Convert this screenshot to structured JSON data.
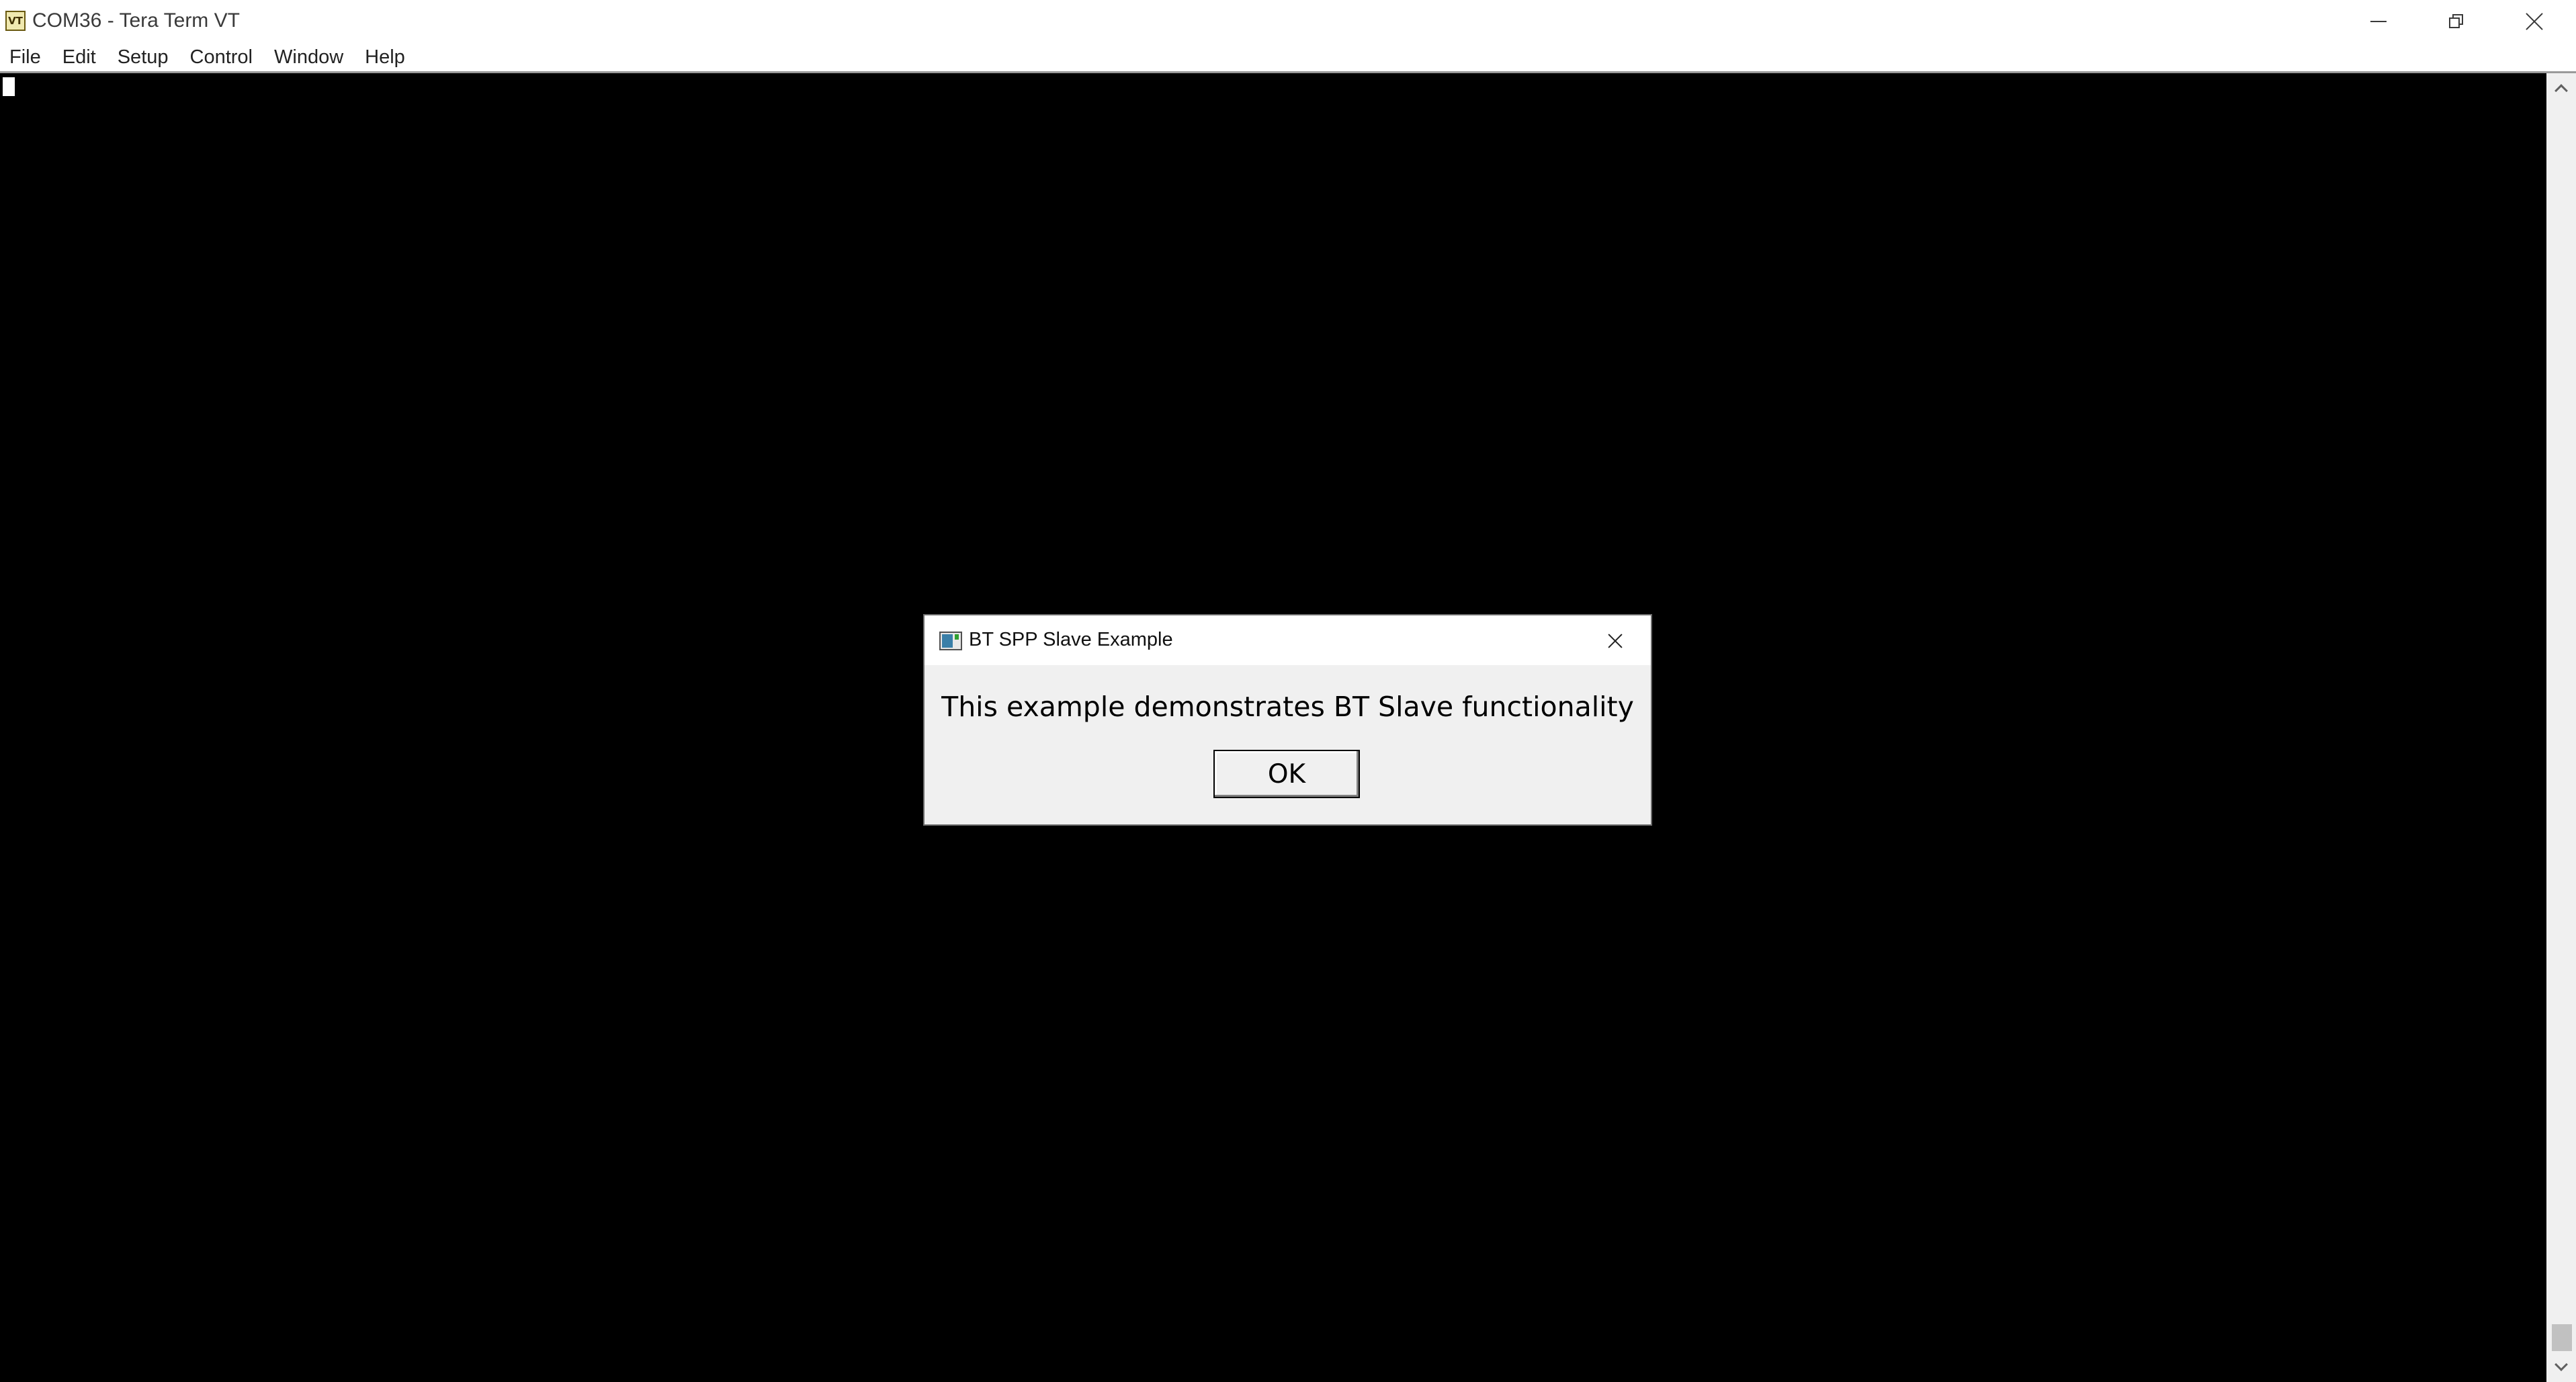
{
  "window": {
    "title": "COM36 - Tera Term VT",
    "icon_text": "VT"
  },
  "menu": {
    "items": [
      "File",
      "Edit",
      "Setup",
      "Control",
      "Window",
      "Help"
    ]
  },
  "dialog": {
    "title": "BT SPP Slave Example",
    "message": "This example demonstrates BT Slave functionality",
    "ok_label": "OK"
  },
  "icons": {
    "app": "tera-term-vt-icon",
    "minimize": "minimize-icon",
    "restore": "restore-icon",
    "close": "close-icon",
    "scroll_up": "chevron-up-icon",
    "scroll_down": "chevron-down-icon",
    "dialog_app": "app-window-icon",
    "dialog_close": "close-icon"
  },
  "colors": {
    "terminal_background": "#000000",
    "cursor": "#ffffff",
    "dialog_background": "#f0f0f0"
  }
}
